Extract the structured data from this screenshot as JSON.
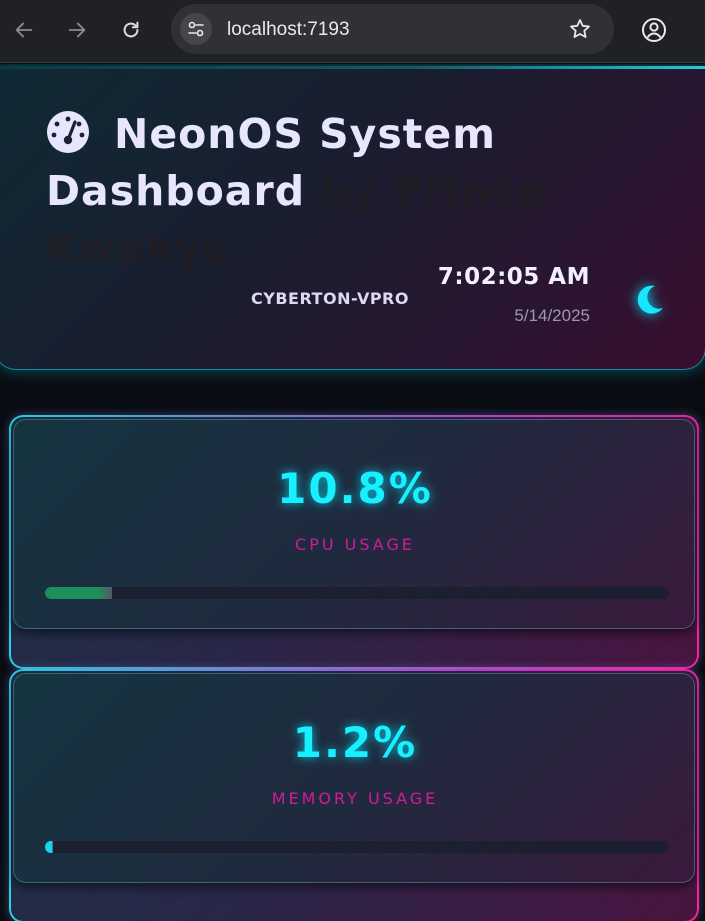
{
  "browser": {
    "url": "localhost:7193"
  },
  "header": {
    "title_main": "NeonOS System Dashboard",
    "title_author": "by Prince Kwakye",
    "hostname": "CYBERTON-VPRO",
    "time": "7:02:05 AM",
    "date": "5/14/2025",
    "icon": "gauge-icon",
    "theme_icon": "moon-icon"
  },
  "stats": [
    {
      "value": "10.8%",
      "label": "CPU USAGE",
      "percent": 10.8,
      "bar_color": "#1f8f5a"
    },
    {
      "value": "1.2%",
      "label": "MEMORY USAGE",
      "percent": 1.2,
      "bar_color": "#18d6f0"
    }
  ],
  "colors": {
    "accent_cyan": "#18f0ff",
    "accent_pink": "#d21a9c"
  }
}
